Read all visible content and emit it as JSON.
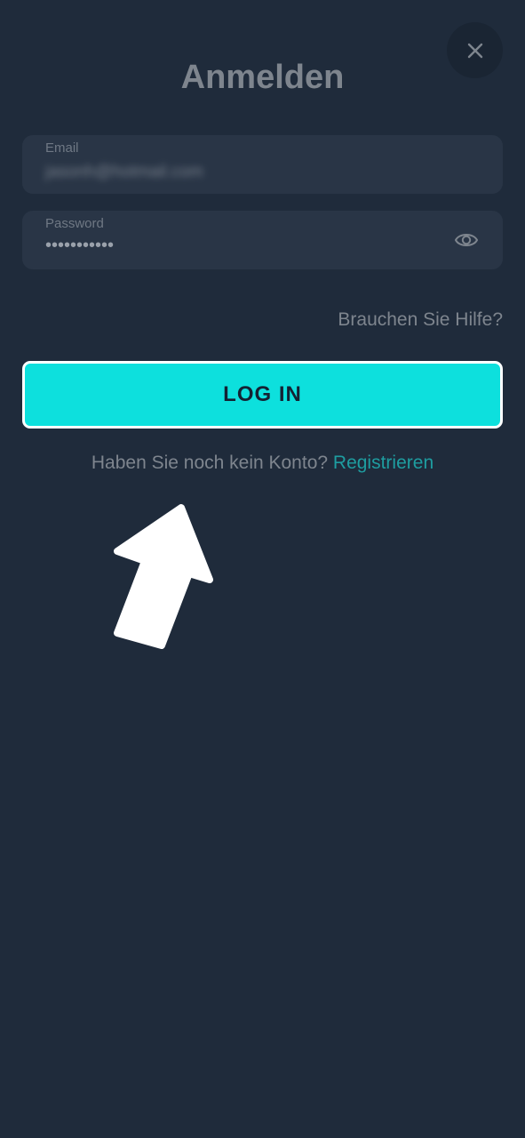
{
  "close": {
    "icon": "close-icon"
  },
  "title": "Anmelden",
  "email": {
    "label": "Email",
    "value": "jasonh@hotmail.com"
  },
  "password": {
    "label": "Password",
    "value": "•••••••••••",
    "toggle_icon": "eye-icon"
  },
  "help_link": "Brauchen Sie Hilfe?",
  "login_button": "LOG IN",
  "signup": {
    "prompt": "Haben Sie noch kein Konto?",
    "link": "Registrieren"
  },
  "colors": {
    "background": "#1f2b3b",
    "accent": "#0de0dd",
    "link": "#1e9da0",
    "field": "#293546"
  },
  "annotation": {
    "icon": "arrow-pointer-icon"
  }
}
